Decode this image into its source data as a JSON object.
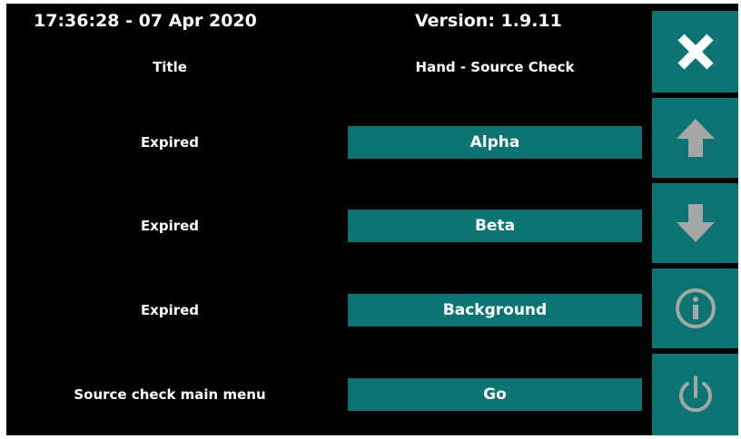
{
  "header": {
    "datetime": "17:36:28 - 07 Apr 2020",
    "version": "Version: 1.9.11"
  },
  "title_row": {
    "label": "Title",
    "value": "Hand - Source Check"
  },
  "rows": [
    {
      "status": "Expired",
      "button": "Alpha"
    },
    {
      "status": "Expired",
      "button": "Beta"
    },
    {
      "status": "Expired",
      "button": "Background"
    },
    {
      "status": "Source check main menu",
      "button": "Go"
    }
  ],
  "sidebar": {
    "icons": [
      "close-icon",
      "arrow-up-icon",
      "arrow-down-icon",
      "info-icon",
      "power-icon"
    ]
  },
  "colors": {
    "accent": "#0d7474",
    "background": "#000000",
    "icon_light": "#a6a6a6"
  }
}
